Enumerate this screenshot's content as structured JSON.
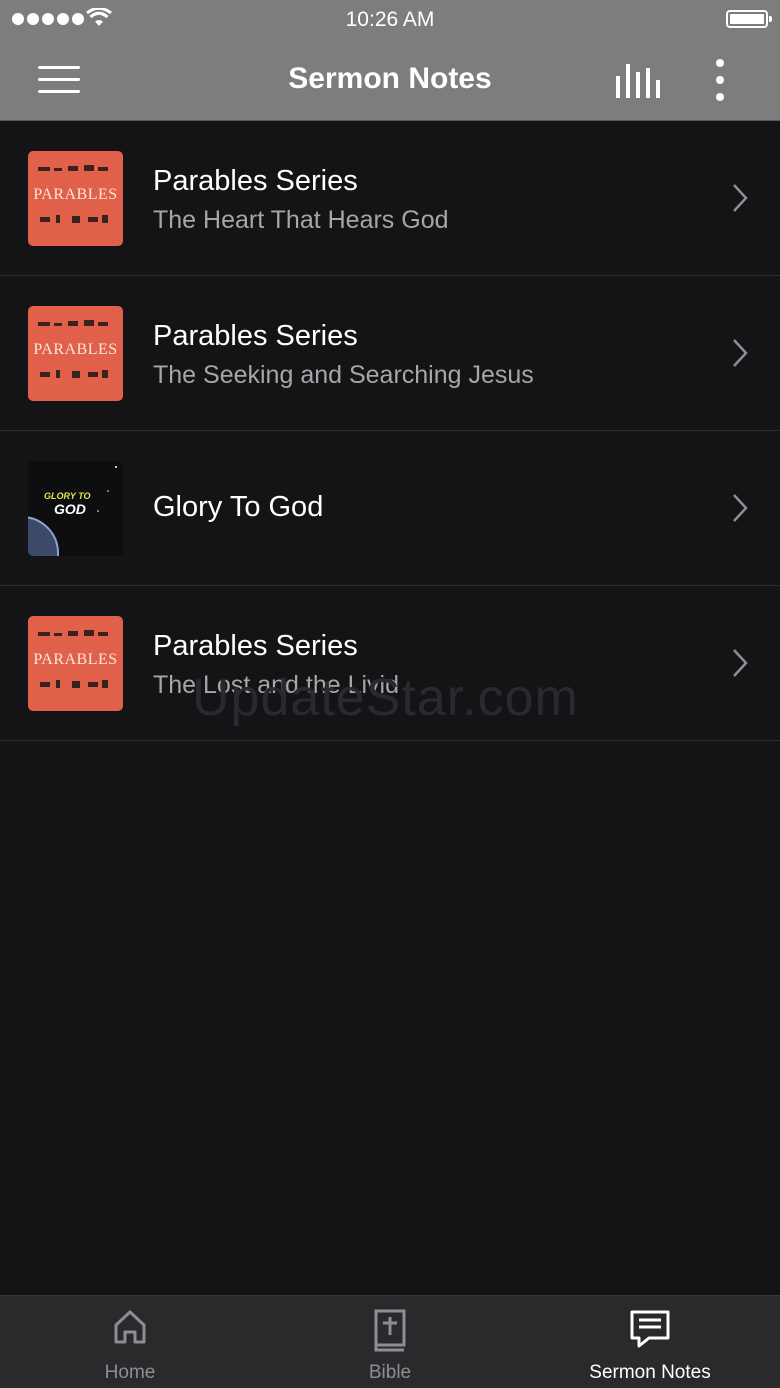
{
  "status_bar": {
    "time": "10:26 AM"
  },
  "header": {
    "title": "Sermon Notes"
  },
  "sermons": [
    {
      "thumb": "parables",
      "thumb_text": "PARABLES",
      "title": "Parables Series",
      "subtitle": "The Heart That Hears God"
    },
    {
      "thumb": "parables",
      "thumb_text": "PARABLES",
      "title": "Parables Series",
      "subtitle": "The Seeking and Searching Jesus"
    },
    {
      "thumb": "glory",
      "thumb_text_top": "GLORY TO",
      "thumb_text_bottom": "GOD",
      "title": "Glory To God"
    },
    {
      "thumb": "parables",
      "thumb_text": "PARABLES",
      "title": "Parables Series",
      "subtitle": "The Lost and the Livid"
    }
  ],
  "watermark": "UpdateStar.com",
  "tabs": [
    {
      "label": "Home",
      "icon": "home-icon",
      "active": false
    },
    {
      "label": "Bible",
      "icon": "bible-icon",
      "active": false
    },
    {
      "label": "Sermon Notes",
      "icon": "notes-icon",
      "active": true
    }
  ],
  "colors": {
    "header_bg": "#7d7d7d",
    "background": "#141417",
    "tabbar_bg": "#2a2a2d",
    "thumb_parables": "#e0604a"
  }
}
